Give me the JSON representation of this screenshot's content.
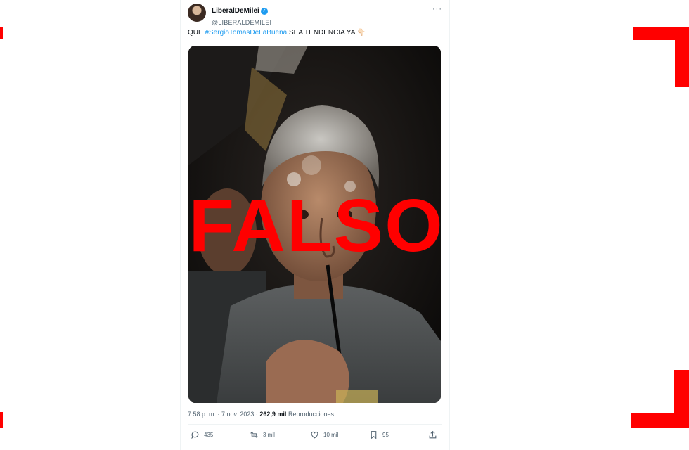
{
  "tweet": {
    "display_name": "LiberalDeMilei",
    "handle": "@LIBERALDEMILEI",
    "more_icon": "more-horizontal-icon",
    "verified_icon": "verified-badge-icon",
    "text_prefix": "QUE ",
    "hashtag": "#SergioTomasDeLaBuena",
    "text_suffix": " SEA TENDENCIA YA ",
    "emoji": "👇🏻",
    "time": "7:58 p. m.",
    "date": "7 nov. 2023",
    "sep": " · ",
    "views_count": "262,9 mil",
    "views_label": " Reproducciones",
    "actions": {
      "replies": "435",
      "reposts": "3 mil",
      "likes": "10 mil",
      "bookmarks": "95"
    }
  },
  "overlay": {
    "stamp_text": "FALSO",
    "stamp_color": "#ff0000"
  },
  "colors": {
    "accent": "#1d9bf0",
    "text": "#0f1419",
    "muted": "#536471"
  }
}
